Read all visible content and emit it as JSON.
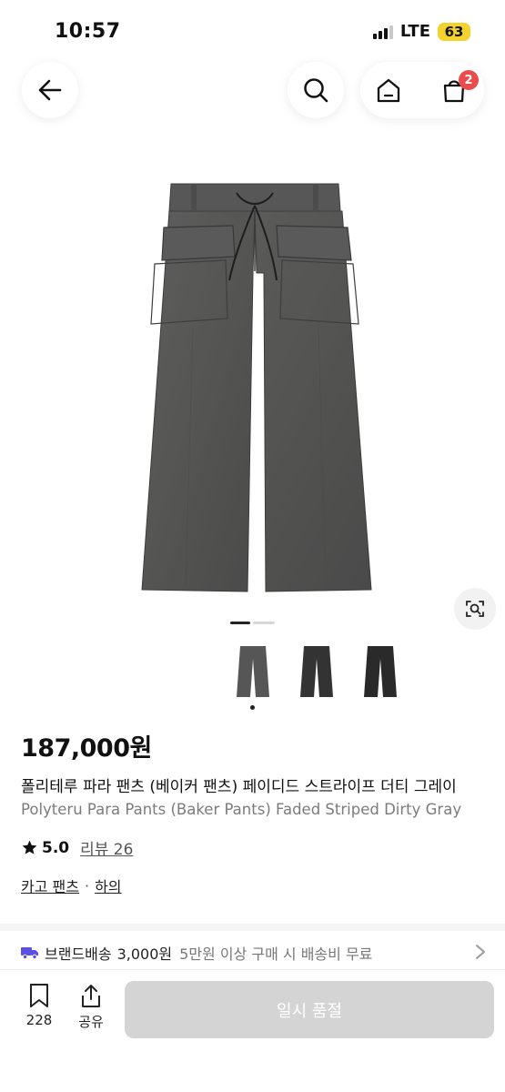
{
  "status_bar": {
    "time": "10:57",
    "network": "LTE",
    "battery": "63"
  },
  "nav": {
    "cart_count": "2"
  },
  "gallery": {
    "thumbnail_count": 3,
    "selected_index": 0
  },
  "product": {
    "price": "187,000원",
    "title_ko": "폴리테루 파라 팬츠 (베이커 팬츠) 페이디드 스트라이프 더티 그레이",
    "title_en": "Polyteru Para Pants (Baker Pants) Faded Striped Dirty Gray",
    "rating": "5.0",
    "review_label": "리뷰 26",
    "category_primary": "카고 팬츠",
    "category_separator": "·",
    "category_secondary": "하의"
  },
  "shipping": {
    "label": "브랜드배송",
    "price": "3,000원",
    "note": "5만원 이상 구매 시 배송비 무료"
  },
  "bottom_bar": {
    "like_count": "228",
    "share_label": "공유",
    "cta_label": "일시 품절"
  },
  "colors": {
    "badge": "#ea4b4b",
    "battery": "#f4d22e",
    "shipping_truck": "#5b4fe8",
    "cta_disabled": "#d4d4d4"
  }
}
